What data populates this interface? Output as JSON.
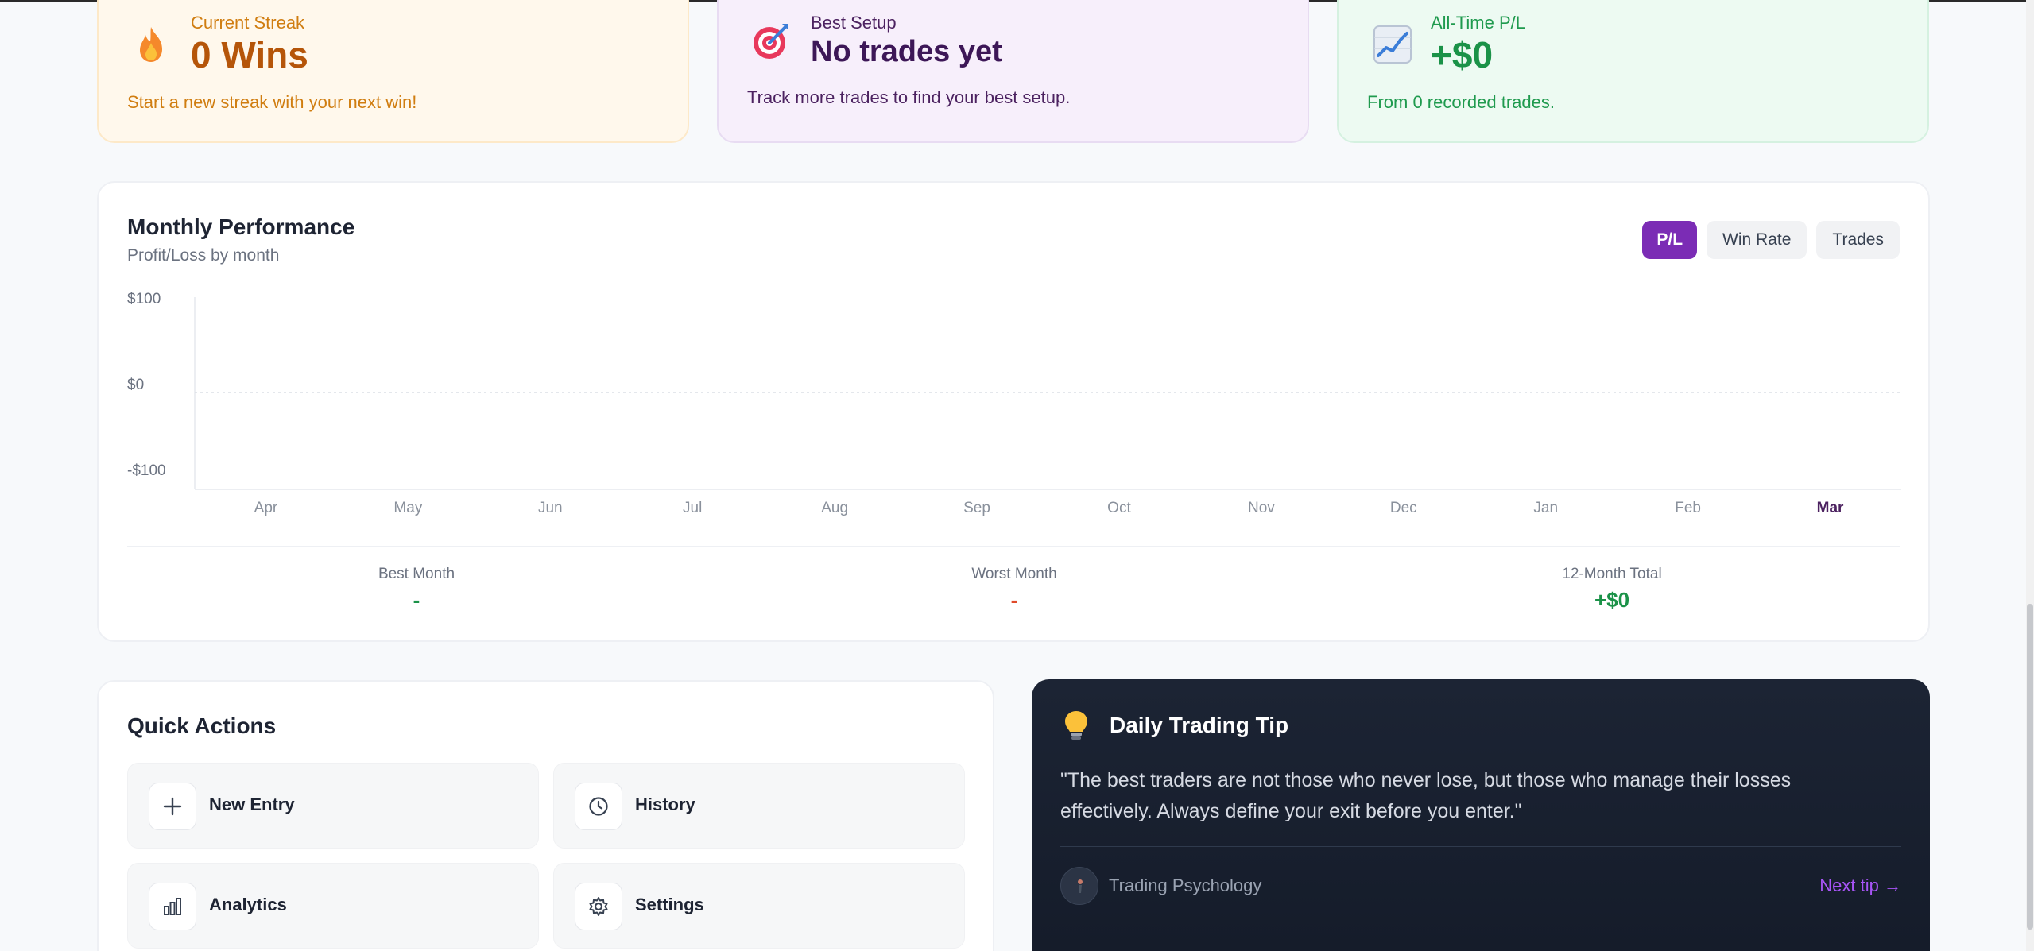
{
  "stats": {
    "streak": {
      "label": "Current Streak",
      "value": "0 Wins",
      "sub": "Start a new streak with your next win!",
      "icon": "fire-icon"
    },
    "setup": {
      "label": "Best Setup",
      "value": "No trades yet",
      "sub": "Track more trades to find your best setup.",
      "icon": "target-icon"
    },
    "pl": {
      "label": "All-Time P/L",
      "value": "+$0",
      "sub": "From 0 recorded trades.",
      "icon": "chart-up-icon"
    }
  },
  "performance": {
    "title": "Monthly Performance",
    "subtitle": "Profit/Loss by month",
    "tabs": [
      {
        "label": "P/L",
        "active": true
      },
      {
        "label": "Win Rate",
        "active": false
      },
      {
        "label": "Trades",
        "active": false
      }
    ],
    "summary": {
      "best": {
        "label": "Best Month",
        "value": "-"
      },
      "worst": {
        "label": "Worst Month",
        "value": "-"
      },
      "total": {
        "label": "12-Month Total",
        "value": "+$0"
      }
    }
  },
  "chart_data": {
    "type": "bar",
    "title": "",
    "xlabel": "",
    "ylabel": "",
    "categories": [
      "Apr",
      "May",
      "Jun",
      "Jul",
      "Aug",
      "Sep",
      "Oct",
      "Nov",
      "Dec",
      "Jan",
      "Feb",
      "Mar"
    ],
    "values": [
      0,
      0,
      0,
      0,
      0,
      0,
      0,
      0,
      0,
      0,
      0,
      0
    ],
    "ylim": [
      -100,
      100
    ],
    "yticks": [
      "$100",
      "$0",
      "-$100"
    ],
    "highlight_category": "Mar",
    "grid": "zero-line dashed",
    "colors": {
      "positive": "#1b9248",
      "negative": "#e04a2a",
      "highlight": "#4c2260",
      "axis_text": "#6b7280"
    }
  },
  "quick_actions": {
    "title": "Quick Actions",
    "items": [
      {
        "label": "New Entry",
        "icon": "plus-icon"
      },
      {
        "label": "History",
        "icon": "clock-icon"
      },
      {
        "label": "Analytics",
        "icon": "bar-chart-icon"
      },
      {
        "label": "Settings",
        "icon": "gear-icon"
      }
    ]
  },
  "tip": {
    "title": "Daily Trading Tip",
    "icon": "lightbulb-icon",
    "quote": "\"The best traders are not those who never lose, but those who manage their losses effectively. Always define your exit before you enter.\"",
    "category": "Trading Psychology",
    "next_label": "Next tip →"
  },
  "colors": {
    "accent": "#7b2cb5",
    "positive": "#1b9248",
    "negative": "#e04a2a",
    "tip_bg": "#1c2434"
  }
}
